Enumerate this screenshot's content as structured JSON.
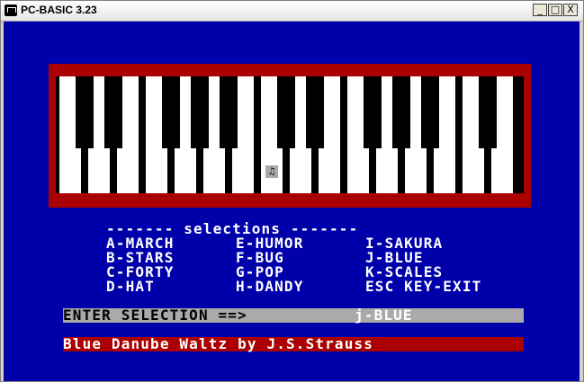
{
  "window": {
    "title": "PC-BASIC 3.23",
    "minimize_glyph": "_",
    "maximize_glyph": "□",
    "close_glyph": "X"
  },
  "piano": {
    "white_key_count": 16,
    "black_key_groups": "2-3-2-3-2",
    "cursor_glyph": "♫"
  },
  "menu": {
    "header": "------- selections -------",
    "col1": [
      "A-MARCH",
      "B-STARS",
      "C-FORTY",
      "D-HAT"
    ],
    "col2": [
      "E-HUMOR",
      "F-BUG",
      "G-POP",
      "H-DANDY"
    ],
    "col3": [
      "I-SAKURA",
      "J-BLUE",
      "K-SCALES",
      "ESC KEY-EXIT"
    ]
  },
  "prompt": {
    "label": "ENTER SELECTION ==> ",
    "value": "j-BLUE"
  },
  "now_playing": "Blue Danube Waltz by J.S.Strauss",
  "colors": {
    "screen_background": "#0000aa",
    "frame_red": "#aa0000",
    "prompt_gray": "#aaaaaa",
    "text": "#ffffff"
  }
}
